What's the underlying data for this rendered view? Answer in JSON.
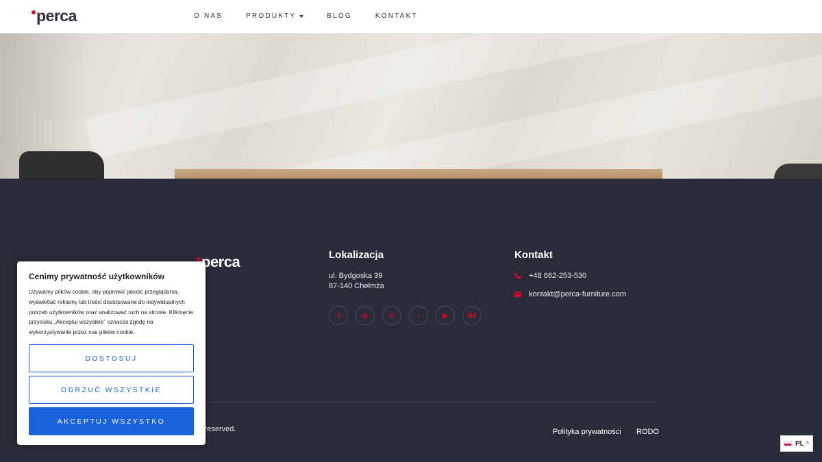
{
  "header": {
    "logo_text": "perca",
    "nav": [
      {
        "label": "O NAS"
      },
      {
        "label": "PRODUKTY",
        "has_dropdown": true
      },
      {
        "label": "BLOG"
      },
      {
        "label": "KONTAKT"
      }
    ]
  },
  "footer": {
    "logo_text": "perca",
    "location": {
      "title": "Lokalizacja",
      "line1": "ul. Bydgoska 39",
      "line2": "87-140 Chełmża"
    },
    "social": [
      {
        "icon": "facebook-icon",
        "glyph": "f"
      },
      {
        "icon": "instagram-icon",
        "glyph": "◎"
      },
      {
        "icon": "pinterest-icon",
        "glyph": "℗"
      },
      {
        "icon": "tiktok-icon",
        "glyph": "♪"
      },
      {
        "icon": "youtube-icon",
        "glyph": "▶"
      },
      {
        "icon": "behance-icon",
        "glyph": "Bē"
      }
    ],
    "contact": {
      "title": "Kontakt",
      "phone": "+48 662-253-530",
      "email": "kontakt@perca-furniture.com"
    },
    "rights_text": "ts reserved.",
    "links": {
      "privacy": "Polityka prywatności",
      "rodo": "RODO"
    },
    "accent_color": "#e4002b",
    "background_color": "#272c38"
  },
  "language": {
    "code": "PL",
    "chevron": "^"
  },
  "cookie_banner": {
    "title": "Cenimy prywatność użytkowników",
    "body": "Używamy plików cookie, aby poprawić jakość przeglądania, wyświetlać reklamy lub treści dostosowane do indywidualnych potrzeb użytkowników oraz analizować ruch na stronie. Kliknięcie przycisku „Akceptuj wszystkie” oznacza zgodę na wykorzystywanie przez nas plików cookie.",
    "customize_label": "DOSTOSUJ",
    "reject_label": "ODRZUĆ WSZYSTKIE",
    "accept_label": "AKCEPTUJ WSZYSTKO",
    "button_color": "#1863dc"
  }
}
